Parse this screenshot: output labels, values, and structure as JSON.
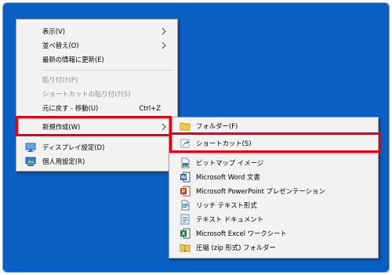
{
  "main_menu": {
    "items": [
      {
        "label": "表示(V)"
      },
      {
        "label": "並べ替え(O)"
      },
      {
        "label": "最新の情報に更新(E)"
      },
      {
        "label": "貼り付け(P)"
      },
      {
        "label": "ショートカットの貼り付け(S)"
      },
      {
        "label": "元に戻す - 移動(U)",
        "shortcut": "Ctrl+Z"
      },
      {
        "label": "新規作成(W)"
      },
      {
        "label": "ディスプレイ設定(D)",
        "icon": "display-icon"
      },
      {
        "label": "個人用設定(R)",
        "icon": "personalize-icon"
      }
    ]
  },
  "sub_menu": {
    "items": [
      {
        "label": "フォルダー(F)",
        "icon": "folder-icon"
      },
      {
        "label": "ショートカット(S)",
        "icon": "shortcut-icon"
      },
      {
        "label": "ビットマップ イメージ",
        "icon": "bitmap-icon"
      },
      {
        "label": "Microsoft Word 文書",
        "icon": "word-icon"
      },
      {
        "label": "Microsoft PowerPoint プレゼンテーション",
        "icon": "powerpoint-icon"
      },
      {
        "label": "リッチ テキスト形式",
        "icon": "rtf-icon"
      },
      {
        "label": "テキスト ドキュメント",
        "icon": "text-document-icon"
      },
      {
        "label": "Microsoft Excel ワークシート",
        "icon": "excel-icon"
      },
      {
        "label": "圧縮 (zip 形式) フォルダー",
        "icon": "zip-folder-icon"
      }
    ]
  },
  "colors": {
    "desktop": "#0a5fc2",
    "menu_bg": "#f2f2f2",
    "highlight_border": "#e60012"
  }
}
